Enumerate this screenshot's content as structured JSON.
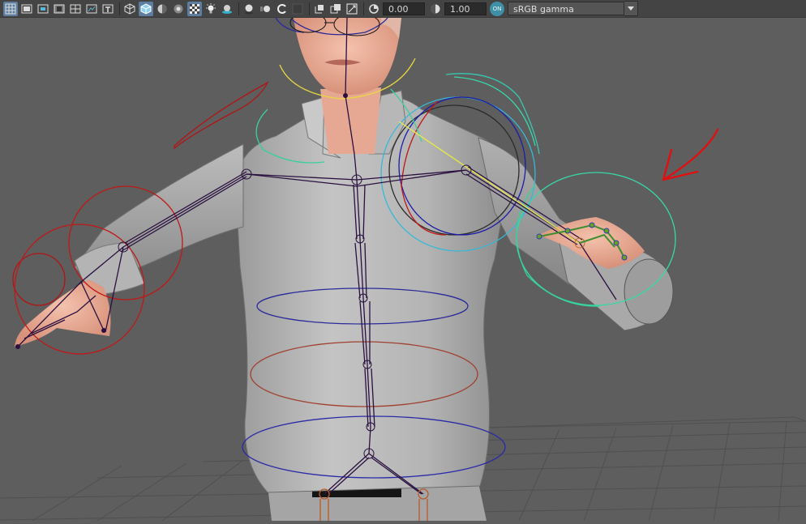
{
  "toolbar": {
    "exposure_value": "0.00",
    "gamma_value": "1.00",
    "color_management_badge": "ON",
    "color_space": "sRGB gamma"
  },
  "colors": {
    "toolbar_bg": "#444444",
    "viewport_bg": "#5e5e5e",
    "joint_color": "#2a1040",
    "annotation_arrow": "#e01010"
  },
  "icons": [
    "grid-icon",
    "film-gate-icon",
    "resolution-gate-icon",
    "gate-mask-icon",
    "field-chart-icon",
    "safe-action-icon",
    "safe-title-icon",
    "wireframe-icon",
    "smooth-shade-icon",
    "default-material-icon",
    "xray-icon",
    "textured-icon",
    "lights-icon",
    "shadows-icon",
    "ambient-occlusion-icon",
    "motion-blur-icon",
    "antialias-icon",
    "isolate-select-icon",
    "xray-joints-icon",
    "xray-active-icon",
    "camera-attributes-icon",
    "exposure-icon",
    "gamma-icon"
  ]
}
